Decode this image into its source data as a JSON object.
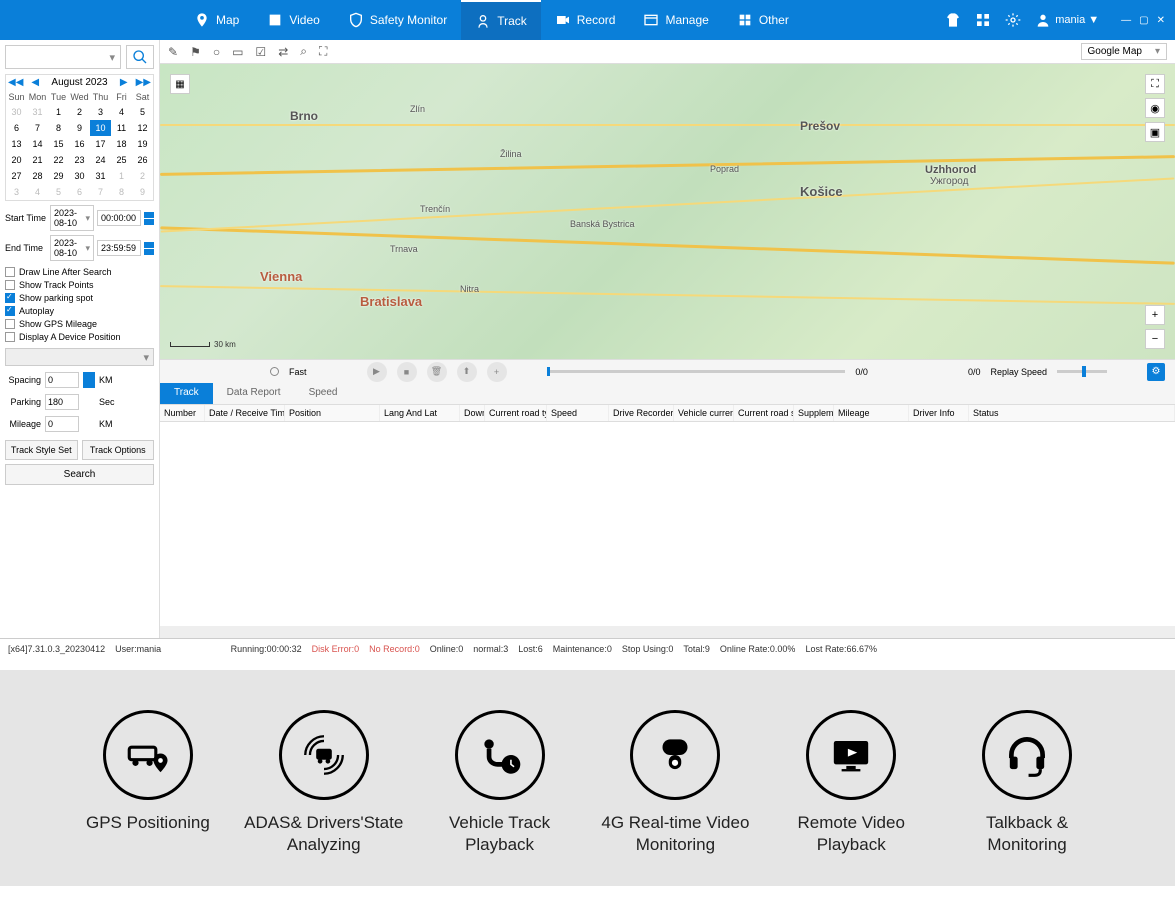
{
  "nav": {
    "map": "Map",
    "video": "Video",
    "safety": "Safety Monitor",
    "track": "Track",
    "record": "Record",
    "manage": "Manage",
    "other": "Other"
  },
  "user": "mania ▼",
  "map_dropdown": "Google Map",
  "calendar": {
    "title": "August 2023",
    "days": [
      "Sun",
      "Mon",
      "Tue",
      "Wed",
      "Thu",
      "Fri",
      "Sat"
    ],
    "cells": [
      {
        "n": "30",
        "om": true
      },
      {
        "n": "31",
        "om": true
      },
      {
        "n": "1"
      },
      {
        "n": "2"
      },
      {
        "n": "3"
      },
      {
        "n": "4"
      },
      {
        "n": "5"
      },
      {
        "n": "6"
      },
      {
        "n": "7"
      },
      {
        "n": "8"
      },
      {
        "n": "9"
      },
      {
        "n": "10",
        "sel": true
      },
      {
        "n": "11"
      },
      {
        "n": "12"
      },
      {
        "n": "13"
      },
      {
        "n": "14"
      },
      {
        "n": "15"
      },
      {
        "n": "16"
      },
      {
        "n": "17"
      },
      {
        "n": "18"
      },
      {
        "n": "19"
      },
      {
        "n": "20"
      },
      {
        "n": "21"
      },
      {
        "n": "22"
      },
      {
        "n": "23"
      },
      {
        "n": "24"
      },
      {
        "n": "25"
      },
      {
        "n": "26"
      },
      {
        "n": "27"
      },
      {
        "n": "28"
      },
      {
        "n": "29"
      },
      {
        "n": "30"
      },
      {
        "n": "31"
      },
      {
        "n": "1",
        "om": true
      },
      {
        "n": "2",
        "om": true
      },
      {
        "n": "3",
        "om": true
      },
      {
        "n": "4",
        "om": true
      },
      {
        "n": "5",
        "om": true
      },
      {
        "n": "6",
        "om": true
      },
      {
        "n": "7",
        "om": true
      },
      {
        "n": "8",
        "om": true
      },
      {
        "n": "9",
        "om": true
      }
    ]
  },
  "time": {
    "start_lbl": "Start Time",
    "start_date": "2023-08-10",
    "start_time": "00:00:00",
    "end_lbl": "End Time",
    "end_date": "2023-08-10",
    "end_time": "23:59:59"
  },
  "checks": {
    "draw_line": "Draw Line After Search",
    "track_points": "Show Track Points",
    "parking_spot": "Show parking spot",
    "autoplay": "Autoplay",
    "gps_mileage": "Show GPS Mileage",
    "device_pos": "Display A Device Position"
  },
  "params": {
    "spacing_lbl": "Spacing",
    "spacing_val": "0",
    "km": "KM",
    "parking_lbl": "Parking",
    "parking_val": "180",
    "sec": "Sec",
    "mileage_lbl": "Mileage",
    "mileage_val": "0"
  },
  "buttons": {
    "style_set": "Track Style Set",
    "options": "Track Options",
    "search": "Search"
  },
  "map_labels": {
    "vienna": "Vienna",
    "bratislava": "Bratislava",
    "brno": "Brno",
    "presov": "Prešov",
    "kosice": "Košice",
    "uzhhorod": "Uzhhorod",
    "ujgorod": "Ужгород",
    "zlin": "Zlín",
    "banska": "Banská Bystrica",
    "trnava": "Trnava",
    "trencin": "Trenčín",
    "poprad": "Poprad",
    "nitra": "Nitra",
    "zilina": "Žilina",
    "scale": "30 km"
  },
  "playback": {
    "fast": "Fast",
    "progress": "0/0",
    "progress2": "0/0",
    "replay_speed": "Replay Speed"
  },
  "tabs": {
    "track": "Track",
    "data_report": "Data Report",
    "speed": "Speed"
  },
  "columns": {
    "number": "Number",
    "date": "Date / Receive Time",
    "position": "Position",
    "lnglat": "Lang And Lat",
    "down": "Down",
    "roadtype": "Current road type",
    "speed": "Speed",
    "drivespeed": "Drive Recorder Speed",
    "vehspeed": "Vehicle current speed",
    "roadspeed": "Current road speed",
    "supplement": "Supplement",
    "mileage": "Mileage",
    "driver": "Driver Info",
    "status": "Status"
  },
  "status": {
    "version": "[x64]7.31.0.3_20230412",
    "user": "User:mania",
    "running": "Running:00:00:32",
    "disk_error": "Disk Error:0",
    "no_record": "No Record:0",
    "online": "Online:0",
    "normal": "normal:3",
    "lost": "Lost:6",
    "maint": "Maintenance:0",
    "stop": "Stop Using:0",
    "total": "Total:9",
    "online_rate": "Online Rate:0.00%",
    "lost_rate": "Lost Rate:66.67%"
  },
  "features": {
    "gps": "GPS Positioning",
    "adas": "ADAS& Drivers'State Analyzing",
    "track": "Vehicle Track Playback",
    "video": "4G Real-time Video Monitoring",
    "remote": "Remote Video Playback",
    "talk": "Talkback & Monitoring"
  }
}
